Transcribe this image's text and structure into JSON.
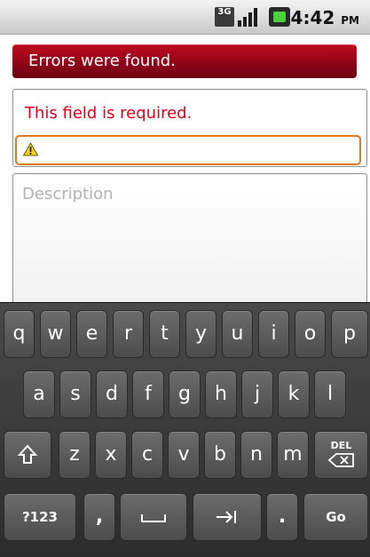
{
  "status_bar": {
    "network": "3G",
    "time": "4:42",
    "ampm": "PM"
  },
  "banner": {
    "text": "Errors were found."
  },
  "field": {
    "error_text": "This field is required.",
    "value": ""
  },
  "description": {
    "placeholder": "Description"
  },
  "keyboard": {
    "row1": [
      "q",
      "w",
      "e",
      "r",
      "t",
      "y",
      "u",
      "i",
      "o",
      "p"
    ],
    "row2": [
      "a",
      "s",
      "d",
      "f",
      "g",
      "h",
      "j",
      "k",
      "l"
    ],
    "row3": [
      "z",
      "x",
      "c",
      "v",
      "b",
      "n",
      "m"
    ],
    "del_label": "DEL",
    "symbols_label": "?123",
    "comma_label": ",",
    "period_label": ".",
    "go_label": "Go"
  }
}
